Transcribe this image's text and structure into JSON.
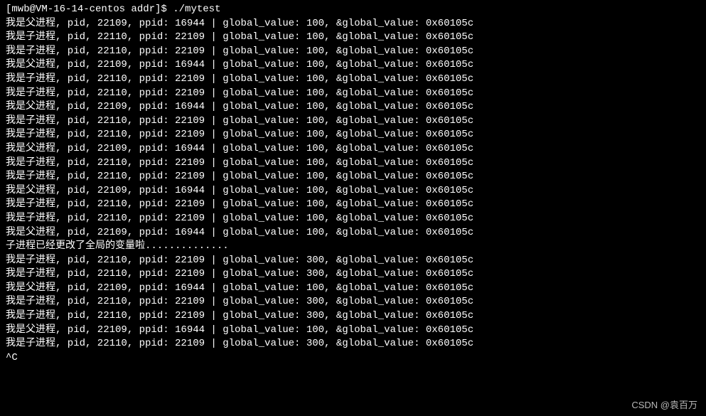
{
  "prompt": {
    "user_host_path": "[mwb@VM-16-14-centos addr]$ ",
    "command": "./mytest"
  },
  "rows": [
    {
      "label": "我是父进程",
      "pid": "22109",
      "ppid": "16944",
      "gv": "100",
      "addr": "0x60105c"
    },
    {
      "label": "我是子进程",
      "pid": "22110",
      "ppid": "22109",
      "gv": "100",
      "addr": "0x60105c"
    },
    {
      "label": "我是子进程",
      "pid": "22110",
      "ppid": "22109",
      "gv": "100",
      "addr": "0x60105c"
    },
    {
      "label": "我是父进程",
      "pid": "22109",
      "ppid": "16944",
      "gv": "100",
      "addr": "0x60105c"
    },
    {
      "label": "我是子进程",
      "pid": "22110",
      "ppid": "22109",
      "gv": "100",
      "addr": "0x60105c"
    },
    {
      "label": "我是子进程",
      "pid": "22110",
      "ppid": "22109",
      "gv": "100",
      "addr": "0x60105c"
    },
    {
      "label": "我是父进程",
      "pid": "22109",
      "ppid": "16944",
      "gv": "100",
      "addr": "0x60105c"
    },
    {
      "label": "我是子进程",
      "pid": "22110",
      "ppid": "22109",
      "gv": "100",
      "addr": "0x60105c"
    },
    {
      "label": "我是子进程",
      "pid": "22110",
      "ppid": "22109",
      "gv": "100",
      "addr": "0x60105c"
    },
    {
      "label": "我是父进程",
      "pid": "22109",
      "ppid": "16944",
      "gv": "100",
      "addr": "0x60105c"
    },
    {
      "label": "我是子进程",
      "pid": "22110",
      "ppid": "22109",
      "gv": "100",
      "addr": "0x60105c"
    },
    {
      "label": "我是子进程",
      "pid": "22110",
      "ppid": "22109",
      "gv": "100",
      "addr": "0x60105c"
    },
    {
      "label": "我是父进程",
      "pid": "22109",
      "ppid": "16944",
      "gv": "100",
      "addr": "0x60105c"
    },
    {
      "label": "我是子进程",
      "pid": "22110",
      "ppid": "22109",
      "gv": "100",
      "addr": "0x60105c"
    },
    {
      "label": "我是子进程",
      "pid": "22110",
      "ppid": "22109",
      "gv": "100",
      "addr": "0x60105c"
    },
    {
      "label": "我是父进程",
      "pid": "22109",
      "ppid": "16944",
      "gv": "100",
      "addr": "0x60105c"
    }
  ],
  "change_msg": "子进程已经更改了全局的变量啦..............",
  "rows_after": [
    {
      "label": "我是子进程",
      "pid": "22110",
      "ppid": "22109",
      "gv": "300",
      "addr": "0x60105c"
    },
    {
      "label": "我是子进程",
      "pid": "22110",
      "ppid": "22109",
      "gv": "300",
      "addr": "0x60105c"
    },
    {
      "label": "我是父进程",
      "pid": "22109",
      "ppid": "16944",
      "gv": "100",
      "addr": "0x60105c"
    },
    {
      "label": "我是子进程",
      "pid": "22110",
      "ppid": "22109",
      "gv": "300",
      "addr": "0x60105c"
    },
    {
      "label": "我是子进程",
      "pid": "22110",
      "ppid": "22109",
      "gv": "300",
      "addr": "0x60105c"
    },
    {
      "label": "我是父进程",
      "pid": "22109",
      "ppid": "16944",
      "gv": "100",
      "addr": "0x60105c"
    },
    {
      "label": "我是子进程",
      "pid": "22110",
      "ppid": "22109",
      "gv": "300",
      "addr": "0x60105c"
    }
  ],
  "interrupt": "^C",
  "watermark": "CSDN @袁百万"
}
